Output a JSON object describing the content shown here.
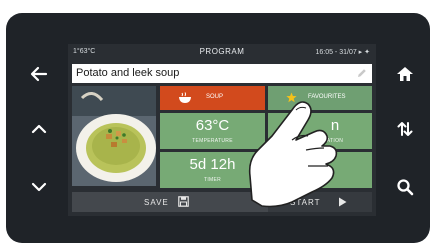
{
  "status": {
    "left": "1°63°C",
    "title": "PROGRAM",
    "right": "16:05 - 31/07 ▸ ✦"
  },
  "recipe": {
    "name": "Potato and leek soup"
  },
  "tiles": {
    "category_label": "SOUP",
    "favourite_label": "FAVOURITES",
    "temperature_value": "63°C",
    "temperature_label": "TEMPERATURE",
    "right2_value": "n",
    "right2_label": "ATION",
    "timer_value": "5d 12h",
    "timer_label": "TIMER"
  },
  "actions": {
    "save_label": "SAVE",
    "start_label": "START"
  },
  "side_buttons": {
    "left": [
      "back-arrow-icon",
      "up-chevron-icon",
      "down-chevron-icon"
    ],
    "right": [
      "home-icon",
      "sort-arrows-icon",
      "search-icon"
    ]
  },
  "colors": {
    "soup_tile": "#d24a1d",
    "green_tile": "#77aa75",
    "device_body": "#1f2328"
  }
}
